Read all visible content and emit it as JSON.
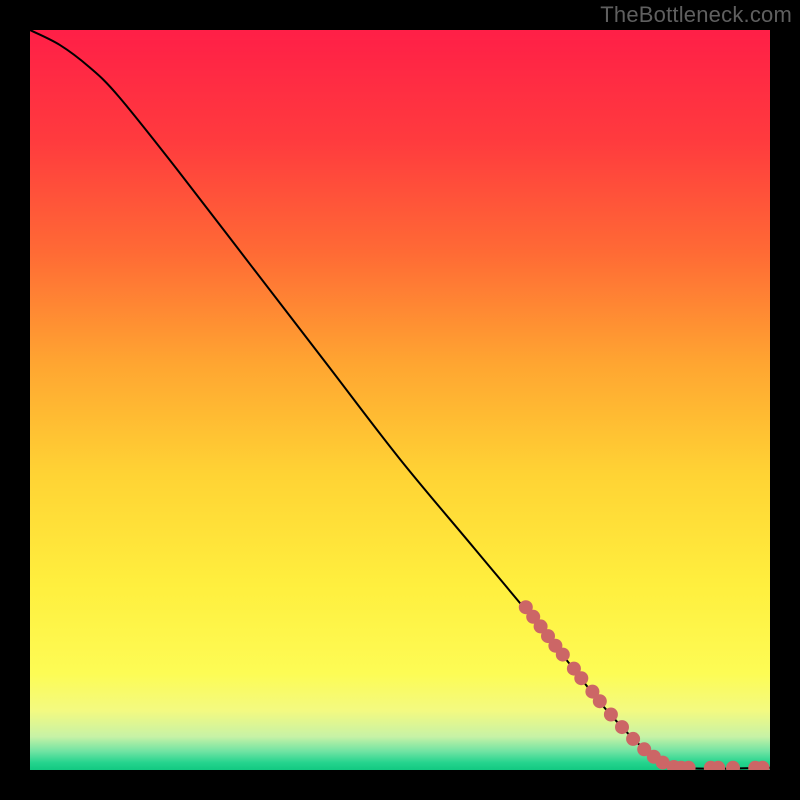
{
  "watermark": "TheBottleneck.com",
  "chart_data": {
    "type": "line",
    "title": "",
    "xlabel": "",
    "ylabel": "",
    "xlim": [
      0,
      100
    ],
    "ylim": [
      0,
      100
    ],
    "curve": {
      "name": "bottleneck-curve",
      "color": "#000000",
      "points": [
        {
          "x": 0,
          "y": 100
        },
        {
          "x": 4,
          "y": 98
        },
        {
          "x": 8,
          "y": 95
        },
        {
          "x": 12,
          "y": 91
        },
        {
          "x": 20,
          "y": 81
        },
        {
          "x": 30,
          "y": 68
        },
        {
          "x": 40,
          "y": 55
        },
        {
          "x": 50,
          "y": 42
        },
        {
          "x": 60,
          "y": 30
        },
        {
          "x": 70,
          "y": 18
        },
        {
          "x": 78,
          "y": 8
        },
        {
          "x": 84,
          "y": 2
        },
        {
          "x": 88,
          "y": 0.3
        },
        {
          "x": 100,
          "y": 0.3
        }
      ]
    },
    "scatter": {
      "name": "data-points",
      "color": "#cc6666",
      "radius": 7,
      "points": [
        {
          "x": 67,
          "y": 22.0
        },
        {
          "x": 68,
          "y": 20.7
        },
        {
          "x": 69,
          "y": 19.4
        },
        {
          "x": 70,
          "y": 18.1
        },
        {
          "x": 71,
          "y": 16.8
        },
        {
          "x": 72,
          "y": 15.6
        },
        {
          "x": 73.5,
          "y": 13.7
        },
        {
          "x": 74.5,
          "y": 12.4
        },
        {
          "x": 76,
          "y": 10.6
        },
        {
          "x": 77,
          "y": 9.3
        },
        {
          "x": 78.5,
          "y": 7.5
        },
        {
          "x": 80,
          "y": 5.8
        },
        {
          "x": 81.5,
          "y": 4.2
        },
        {
          "x": 83,
          "y": 2.8
        },
        {
          "x": 84.3,
          "y": 1.8
        },
        {
          "x": 85.5,
          "y": 1.0
        },
        {
          "x": 87,
          "y": 0.4
        },
        {
          "x": 88,
          "y": 0.3
        },
        {
          "x": 89,
          "y": 0.3
        },
        {
          "x": 92,
          "y": 0.3
        },
        {
          "x": 93,
          "y": 0.3
        },
        {
          "x": 95,
          "y": 0.3
        },
        {
          "x": 98,
          "y": 0.3
        },
        {
          "x": 99,
          "y": 0.3
        }
      ]
    },
    "background_gradient": {
      "type": "vertical",
      "stops": [
        {
          "pos": 0.0,
          "color": "#ff1f47"
        },
        {
          "pos": 0.15,
          "color": "#ff3b3e"
        },
        {
          "pos": 0.3,
          "color": "#ff6a35"
        },
        {
          "pos": 0.45,
          "color": "#ffa531"
        },
        {
          "pos": 0.6,
          "color": "#ffd334"
        },
        {
          "pos": 0.75,
          "color": "#ffef3e"
        },
        {
          "pos": 0.87,
          "color": "#fdfc55"
        },
        {
          "pos": 0.92,
          "color": "#f3fa81"
        },
        {
          "pos": 0.955,
          "color": "#c7f2a6"
        },
        {
          "pos": 0.975,
          "color": "#6fe3a3"
        },
        {
          "pos": 0.99,
          "color": "#25d48e"
        },
        {
          "pos": 1.0,
          "color": "#12c981"
        }
      ]
    }
  }
}
